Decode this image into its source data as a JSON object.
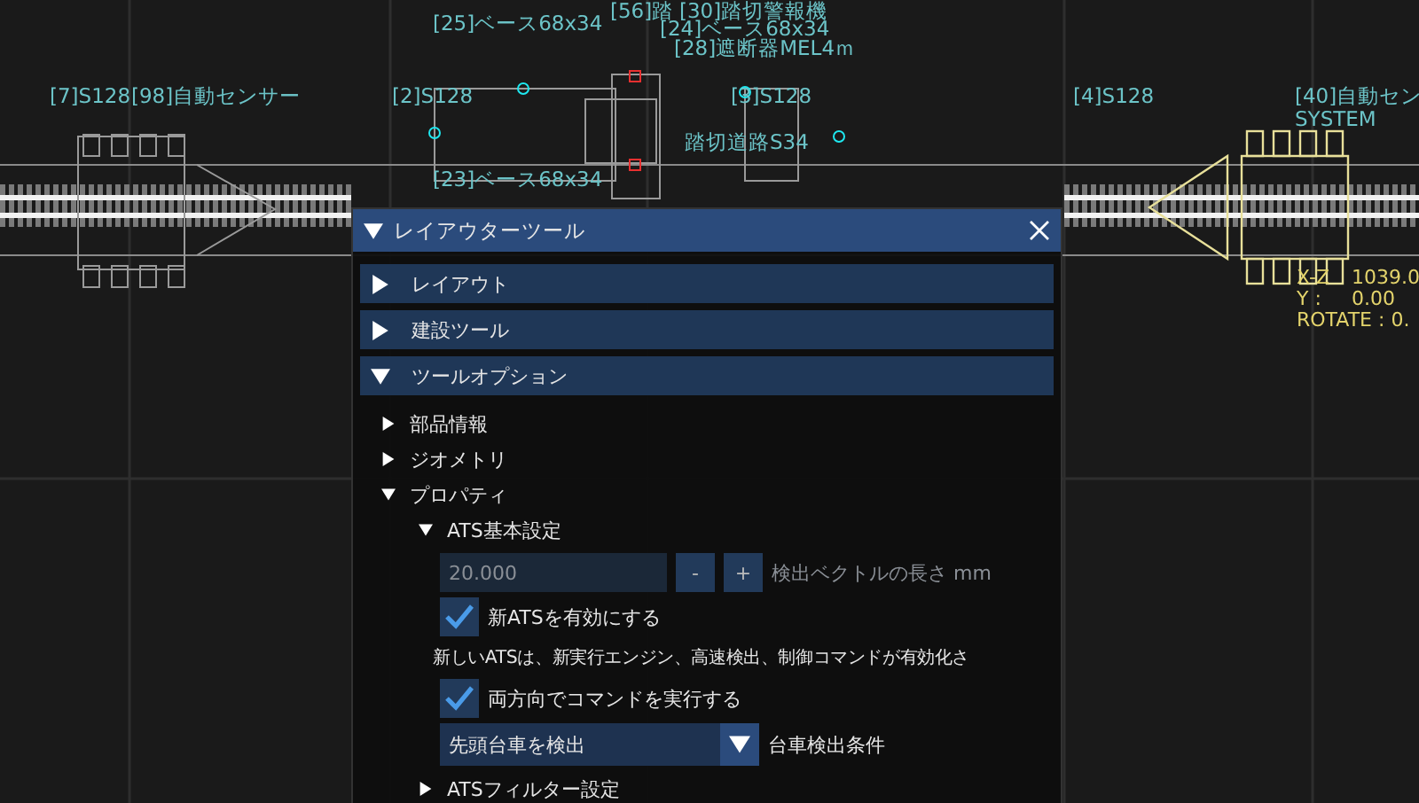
{
  "canvas_labels": [
    {
      "text": "[7]S128"
    },
    {
      "text": "[98]自動センサー"
    },
    {
      "text": "[25]ベース68x34"
    },
    {
      "text": "[2]S128"
    },
    {
      "text": "[56]踏"
    },
    {
      "text": "[30]踏切警報機"
    },
    {
      "text": "[24]ベース68x34"
    },
    {
      "text": "[28]遮断器MEL4ｍ"
    },
    {
      "text": "[3]S128"
    },
    {
      "text": "踏切道路S34"
    },
    {
      "text": "[23]ベース68x34"
    },
    {
      "text": "[4]S128"
    },
    {
      "text": "[40]自動セン"
    },
    {
      "text": "SYSTEM"
    }
  ],
  "coordinates": {
    "xz_label": "X-Z",
    "xz_value": "1039.0",
    "y_label": "Y :",
    "y_value": "0.00",
    "rotate": "ROTATE : 0."
  },
  "tool_window": {
    "title": "レイアウターツール",
    "expanded": true,
    "sections": [
      {
        "label": "レイアウト",
        "expanded": false
      },
      {
        "label": "建設ツール",
        "expanded": false
      },
      {
        "label": "ツールオプション",
        "expanded": true,
        "children": [
          {
            "label": "部品情報",
            "expanded": false
          },
          {
            "label": "ジオメトリ",
            "expanded": false
          },
          {
            "label": "プロパティ",
            "expanded": true,
            "children": [
              {
                "label": "ATS基本設定",
                "expanded": true,
                "controls": [
                  {
                    "kind": "number",
                    "value": "20.000",
                    "minus": "-",
                    "plus": "+",
                    "caption": "検出ベクトルの長さ mm"
                  },
                  {
                    "kind": "checkbox",
                    "checked": true,
                    "label": "新ATSを有効にする"
                  },
                  {
                    "kind": "text",
                    "text": "新しいATSは、新実行エンジン、高速検出、制御コマンドが有効化さ"
                  },
                  {
                    "kind": "checkbox",
                    "checked": true,
                    "label": "両方向でコマンドを実行する"
                  },
                  {
                    "kind": "dropdown",
                    "value": "先頭台車を検出",
                    "caption": "台車検出条件"
                  }
                ]
              },
              {
                "label": "ATSフィルター設定",
                "expanded": false
              }
            ]
          }
        ]
      }
    ]
  }
}
